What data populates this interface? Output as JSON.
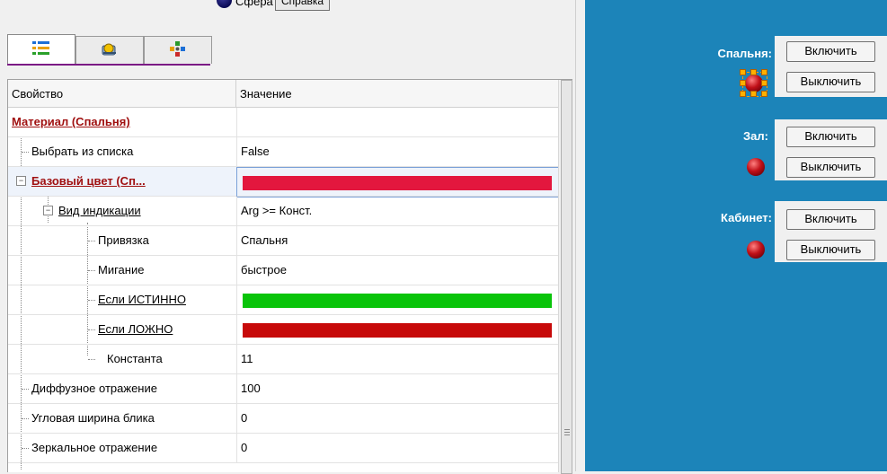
{
  "top": {
    "sphere_label": "Сфера",
    "help_button": "Справка"
  },
  "tabs": [
    {
      "icon": "property-list-icon",
      "active": true
    },
    {
      "icon": "events-icon",
      "active": false
    },
    {
      "icon": "animation-icon",
      "active": false
    }
  ],
  "grid": {
    "headers": {
      "property": "Свойство",
      "value": "Значение"
    },
    "rows": [
      {
        "name": "Материал (Спальня)",
        "value": ""
      },
      {
        "name": "Выбрать из списка",
        "value": "False"
      },
      {
        "name": "Базовый цвет (Сп...",
        "value": "",
        "color": "#e3173e"
      },
      {
        "name": "Вид индикации",
        "value": "Arg >= Конст."
      },
      {
        "name": "Привязка",
        "value": "Спальня"
      },
      {
        "name": "Мигание",
        "value": "быстрое"
      },
      {
        "name": "Если ИСТИННО",
        "value": "",
        "color": "#09c40a"
      },
      {
        "name": "Если ЛОЖНО",
        "value": "",
        "color": "#c70a0a"
      },
      {
        "name": "Константа",
        "value": "11"
      },
      {
        "name": "Диффузное отражение",
        "value": "100"
      },
      {
        "name": "Угловая ширина блика",
        "value": "0"
      },
      {
        "name": "Зеркальное отражение",
        "value": "0"
      }
    ]
  },
  "rooms": [
    {
      "label": "Спальня:",
      "on": "Включить",
      "off": "Выключить",
      "selected": true
    },
    {
      "label": "Зал:",
      "on": "Включить",
      "off": "Выключить",
      "selected": false
    },
    {
      "label": "Кабинет:",
      "on": "Включить",
      "off": "Выключить",
      "selected": false
    }
  ],
  "colors": {
    "canvas_bg": "#1c84b9",
    "tab_accent": "#7b1a85",
    "lamp": "#c01018"
  }
}
